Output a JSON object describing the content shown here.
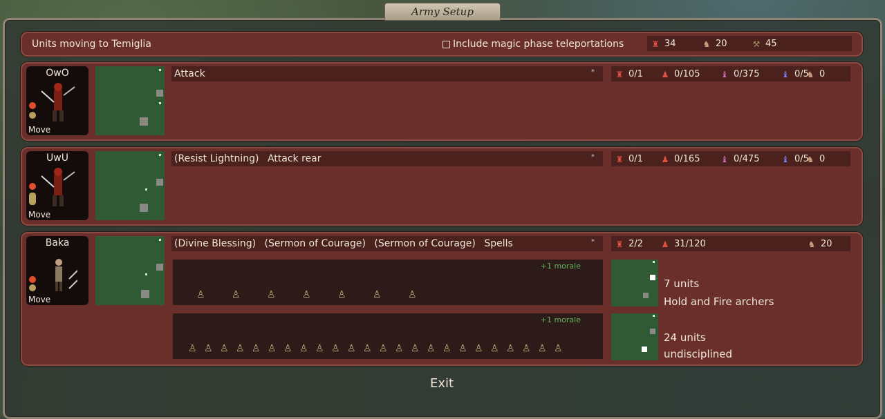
{
  "window": {
    "title": "Army Setup"
  },
  "summary": {
    "text": "Units moving to Temiglia",
    "checkbox_label": "Include magic phase teleportations",
    "totals": [
      {
        "icon": "commander-icon",
        "value": "34"
      },
      {
        "icon": "horse-icon",
        "value": "20"
      },
      {
        "icon": "supply-icon",
        "value": "45"
      }
    ]
  },
  "commanders": [
    {
      "name": "OwO",
      "status": "Move",
      "orders": [
        "Attack"
      ],
      "stats": [
        {
          "icon": "leadership-icon",
          "value": "0/1"
        },
        {
          "icon": "units-icon",
          "value": "0/105"
        },
        {
          "icon": "magic-leadership-icon",
          "value": "0/375"
        },
        {
          "icon": "undead-leadership-icon",
          "value": "0/5"
        },
        {
          "icon": "mount-icon",
          "value": "0"
        }
      ]
    },
    {
      "name": "UwU",
      "status": "Move",
      "orders": [
        "(Resist Lightning)",
        "Attack rear"
      ],
      "stats": [
        {
          "icon": "leadership-icon",
          "value": "0/1"
        },
        {
          "icon": "units-icon",
          "value": "0/165"
        },
        {
          "icon": "magic-leadership-icon",
          "value": "0/475"
        },
        {
          "icon": "undead-leadership-icon",
          "value": "0/5"
        },
        {
          "icon": "mount-icon",
          "value": "0"
        }
      ]
    },
    {
      "name": "Baka",
      "status": "Move",
      "orders": [
        "(Divine Blessing)",
        "(Sermon of Courage)",
        "(Sermon of Courage)",
        "Spells"
      ],
      "stats": [
        {
          "icon": "leadership-icon",
          "value": "2/2"
        },
        {
          "icon": "units-icon",
          "value": "31/120"
        },
        {
          "icon": "mount-icon",
          "value": "20"
        }
      ],
      "squads": [
        {
          "count": "7 units",
          "order": "Hold and Fire archers",
          "morale": "+1 morale",
          "soldiers": 7
        },
        {
          "count": "24 units",
          "order": "undisciplined",
          "morale": "+1 morale",
          "soldiers": 24
        }
      ]
    }
  ],
  "footer": {
    "exit_label": "Exit"
  }
}
